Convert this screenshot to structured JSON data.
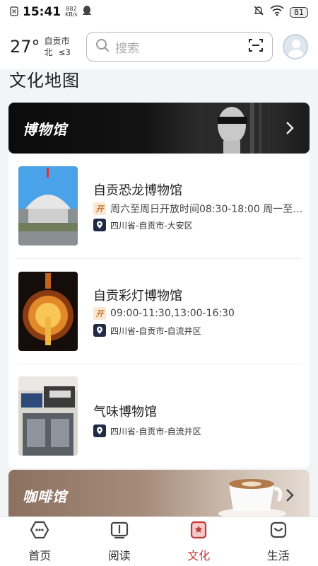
{
  "status": {
    "time": "15:41",
    "speed_top": "882",
    "speed_bottom": "KB/s",
    "battery": "81"
  },
  "weather": {
    "temp": "27°",
    "city": "自贡市",
    "wind_dir": "北",
    "wind_level": "≤3"
  },
  "search": {
    "placeholder": "搜索"
  },
  "page_title": "文化地图",
  "banners": {
    "museum": "博物馆",
    "cafe": "咖啡馆"
  },
  "museums": [
    {
      "name": "自贡恐龙博物馆",
      "hours": "周六至周日开放时间08:30-18:00 周一至…",
      "address": "四川省-自贡市-大安区",
      "open_tag": "开"
    },
    {
      "name": "自贡彩灯博物馆",
      "hours": "09:00-11:30,13:00-16:30",
      "address": "四川省-自贡市-自流井区",
      "open_tag": "开"
    },
    {
      "name": "气味博物馆",
      "hours": "",
      "address": "四川省-自贡市-自流井区",
      "open_tag": ""
    }
  ],
  "nav": [
    {
      "label": "首页",
      "icon": "home-icon"
    },
    {
      "label": "阅读",
      "icon": "book-icon"
    },
    {
      "label": "文化",
      "icon": "culture-icon",
      "active": true
    },
    {
      "label": "生活",
      "icon": "life-icon"
    }
  ],
  "colors": {
    "accent": "#c23a3a",
    "museum_banner": "#0b0b0b",
    "cafe_banner": "#8c7060"
  }
}
